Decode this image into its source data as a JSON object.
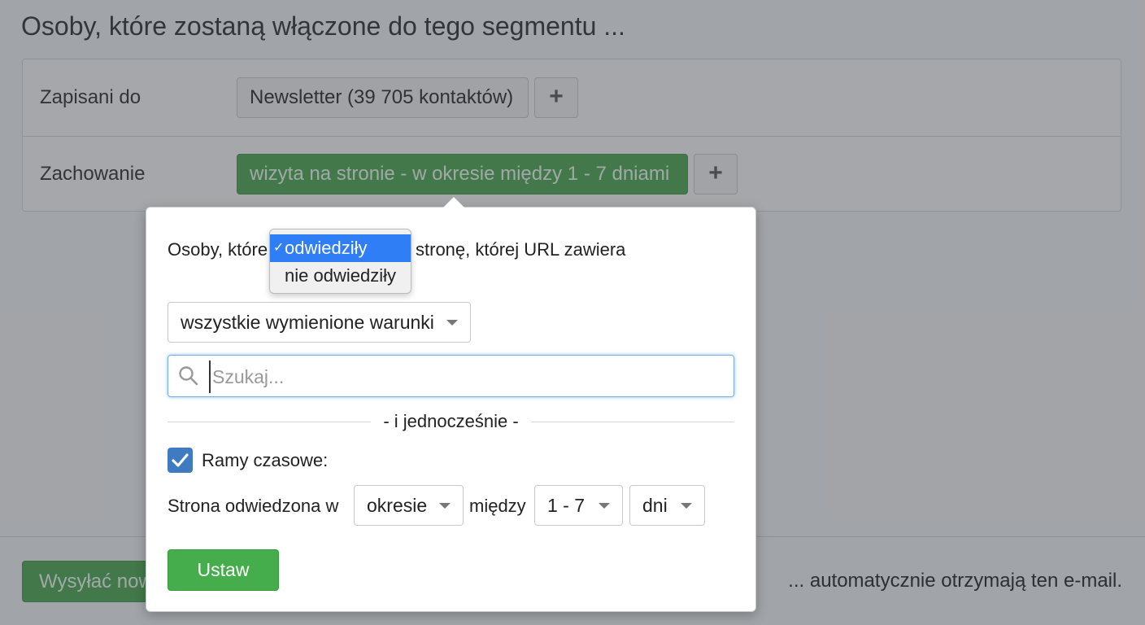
{
  "page": {
    "title": "Osoby, które zostaną włączone do tego segmentu ..."
  },
  "segment": {
    "rows": [
      {
        "label": "Zapisani do",
        "chip": "Newsletter (39 705 kontaktów)"
      },
      {
        "label": "Zachowanie",
        "chip": "wizyta na stronie - w okresie między 1 - 7 dniami"
      }
    ],
    "add_label": "+"
  },
  "footer": {
    "send_button": "Wysyłać nowy",
    "auto_text": "... automatycznie otrzymają ten e-mail."
  },
  "popover": {
    "sentence_start": "Osoby, które",
    "sentence_end": "stronę, której URL zawiera",
    "visit_dropdown": {
      "options": [
        "odwiedziły",
        "nie odwiedziły"
      ],
      "selected": "odwiedziły",
      "check": "✓"
    },
    "match_select": "wszystkie wymienione warunki",
    "search": {
      "placeholder": "Szukaj...",
      "value": ""
    },
    "divider": "- i jednocześnie -",
    "timeframe": {
      "checked": true,
      "label": "Ramy czasowe:"
    },
    "time_row": {
      "prefix": "Strona odwiedzona w",
      "period": "okresie",
      "between": "między",
      "range": "1 - 7",
      "unit": "dni"
    },
    "set_button": "Ustaw"
  },
  "colors": {
    "green": "#4aa74f",
    "selected_blue": "#2f7ef6",
    "checkbox_blue": "#3f7bc0"
  },
  "icons": [
    "plus-icon",
    "search-icon",
    "check-icon",
    "caret-down-icon"
  ]
}
